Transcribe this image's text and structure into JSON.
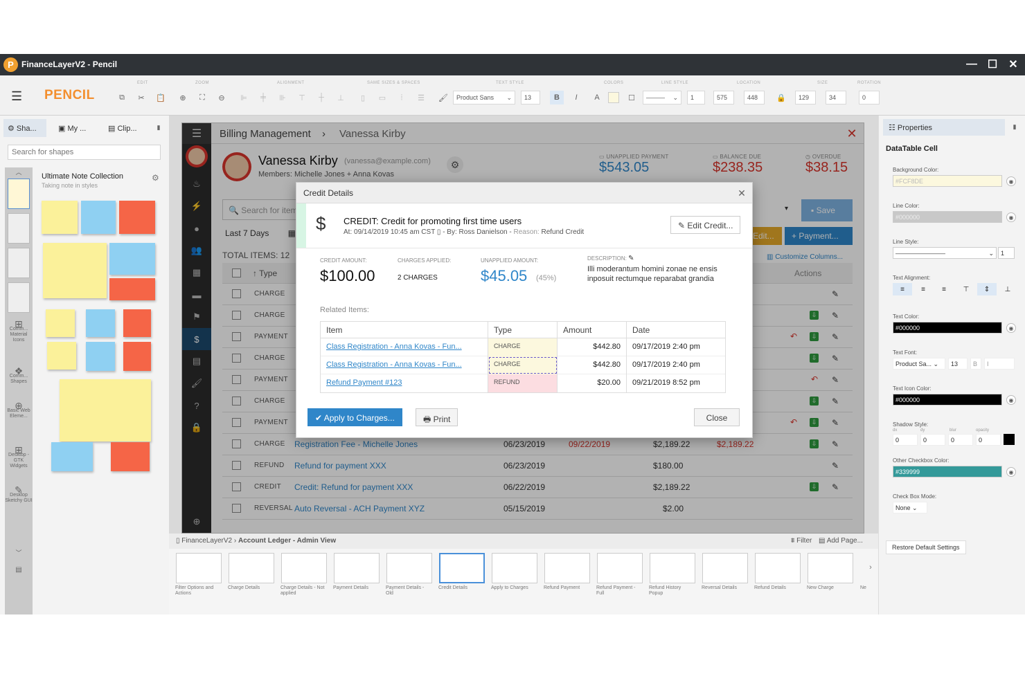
{
  "window": {
    "title": "FinanceLayerV2 - Pencil",
    "logo": "P"
  },
  "toolbar": {
    "brand": "PENCIL",
    "groups": [
      "EDIT",
      "ZOOM",
      "ALIGNMENT",
      "SAME SIZES & SPACES",
      "TEXT STYLE",
      "COLORS",
      "LINE STYLE",
      "LOCATION",
      "SIZE",
      "ROTATION"
    ],
    "font": "Product Sans",
    "font_size": "13",
    "bold": "B",
    "italic": "I",
    "text_color": "A",
    "line_width": "1",
    "x": "575",
    "y": "448",
    "width": "129",
    "height": "34",
    "rotation": "0"
  },
  "left_panel": {
    "tabs": [
      "Sha...",
      "My ...",
      "Clip..."
    ],
    "search_placeholder": "Search for shapes",
    "collection_title": "Ultimate Note Collection",
    "collection_sub": "Taking note in styles",
    "rail_items": [
      "Comm... Material Icons",
      "Comm... Shapes",
      "Basic Web Eleme...",
      "Desktop - GTK Widgets",
      "Desktop Sketchy GUI"
    ]
  },
  "mock": {
    "breadcrumb": [
      "Billing Management",
      "Vanessa Kirby"
    ],
    "customer_name": "Vanessa Kirby",
    "customer_email": "(vanessa@example.com)",
    "members": "Members: Michelle Jones + Anna Kovas",
    "kpis": [
      {
        "label": "UNAPPLIED PAYMENT",
        "value": "$543.05",
        "color": "#2f86c9"
      },
      {
        "label": "BALANCE DUE",
        "value": "$238.35",
        "color": "#d9342b"
      },
      {
        "label": "OVERDUE",
        "value": "$38.15",
        "color": "#d9342b"
      }
    ],
    "search_placeholder": "Search for item",
    "date_filter": "Last 7 Days",
    "save_label": "Save",
    "edit_label": "Edit...",
    "payment_label": "Payment...",
    "total_items": "TOTAL ITEMS: 12",
    "customize_columns": "Customize Columns...",
    "col_type": "Type",
    "col_actions": "Actions",
    "rows": [
      {
        "type": "CHARGE",
        "desc": "",
        "date": "",
        "due": "",
        "amount": "",
        "balance": ""
      },
      {
        "type": "CHARGE",
        "desc": "",
        "date": "",
        "due": "",
        "amount": "",
        "balance": ""
      },
      {
        "type": "PAYMENT",
        "desc": "",
        "date": "",
        "due": "",
        "amount": "",
        "balance": ""
      },
      {
        "type": "CHARGE",
        "desc": "",
        "date": "",
        "due": "",
        "amount": "",
        "balance": ""
      },
      {
        "type": "PAYMENT",
        "desc": "",
        "date": "",
        "due": "",
        "amount": "",
        "balance": ""
      },
      {
        "type": "CHARGE",
        "desc": "",
        "date": "",
        "due": "",
        "amount": "",
        "balance": ""
      },
      {
        "type": "PAYMENT",
        "desc": "",
        "date": "",
        "due": "",
        "amount": "",
        "balance": ""
      },
      {
        "type": "CHARGE",
        "desc": "Registration Fee - Michelle Jones",
        "date": "06/23/2019",
        "due": "09/22/2019",
        "amount": "$2,189.22",
        "balance": "$2,189.22"
      },
      {
        "type": "REFUND",
        "desc": "Refund for payment XXX",
        "date": "06/23/2019",
        "due": "",
        "amount": "$180.00",
        "balance": ""
      },
      {
        "type": "CREDIT",
        "desc": "Credit: Refund for payment XXX",
        "date": "06/22/2019",
        "due": "",
        "amount": "$2,189.22",
        "balance": ""
      },
      {
        "type": "REVERSAL",
        "desc": "Auto Reversal - ACH Payment XYZ",
        "date": "05/15/2019",
        "due": "",
        "amount": "$2.00",
        "balance": ""
      }
    ]
  },
  "dialog": {
    "title": "Credit Details",
    "credit_title": "CREDIT: Credit for promoting first time users",
    "meta_at": "At: 09/14/2019 10:45 am CST",
    "meta_by": "- By: Ross Danielson - ",
    "meta_reason_label": "Reason: ",
    "meta_reason": "Refund Credit",
    "edit_credit": "Edit Credit...",
    "credit_amount_label": "CREDIT AMOUNT:",
    "credit_amount": "$100.00",
    "charges_applied_label": "CHARGES APPLIED:",
    "charges_applied": "2 CHARGES",
    "unapplied_label": "UNAPPLIED AMOUNT:",
    "unapplied": "$45.05",
    "unapplied_pct": "(45%)",
    "description_label": "DESCRIPTION:",
    "description": "Illi moderantum homini zonae ne ensis inposuit rectumque reparabat grandia",
    "related_label": "Related Items:",
    "columns": [
      "Item",
      "Type",
      "Amount",
      "Date"
    ],
    "items": [
      {
        "item": "Class Registration - Anna Kovas - Fun...",
        "type": "CHARGE",
        "amount": "$442.80",
        "date": "09/17/2019 2:40 pm"
      },
      {
        "item": "Class Registration - Anna Kovas - Fun...",
        "type": "CHARGE",
        "amount": "$442.80",
        "date": "09/17/2019 2:40 pm"
      },
      {
        "item": "Refund Payment #123",
        "type": "REFUND",
        "amount": "$20.00",
        "date": "09/21/2019 8:52 pm"
      }
    ],
    "apply_label": "Apply to Charges...",
    "print_label": "Print",
    "close_label": "Close"
  },
  "bottom": {
    "crumb_root": "FinanceLayerV2",
    "crumb_page": "Account Ledger - Admin View",
    "filter": "Filter",
    "add_page": "Add Page...",
    "pages": [
      "Filter Options and Actions",
      "Charge Details",
      "Charge Details - Not applied",
      "Payment Details",
      "Payment Details - Old",
      "Credit Details",
      "Apply to Charges",
      "Refund Payment",
      "Refund Payment - Full",
      "Refund History Popup",
      "Reversal Details",
      "Refund Details",
      "New Charge",
      "Ne"
    ]
  },
  "properties": {
    "tab": "Properties",
    "heading": "DataTable Cell",
    "bg_label": "Background Color:",
    "bg_value": "#FCF8DE",
    "line_color_label": "Line Color:",
    "line_color_value": "#000000",
    "line_style_label": "Line Style:",
    "line_style_value": "1",
    "text_align_label": "Text Alignment:",
    "text_color_label": "Text Color:",
    "text_color_value": "#000000",
    "text_font_label": "Text Font:",
    "text_font_value": "Product Sa...",
    "text_font_size": "13",
    "text_font_b": "B",
    "text_font_i": "I",
    "icon_color_label": "Text Icon Color:",
    "icon_color_value": "#000000",
    "shadow_label": "Shadow Style:",
    "shadow_sub": [
      "dx",
      "dy",
      "blur",
      "opacity"
    ],
    "shadow_vals": [
      "0",
      "0",
      "0",
      "0"
    ],
    "other_cb_label": "Other Checkbox Color:",
    "other_cb_value": "#339999",
    "cb_mode_label": "Check Box Mode:",
    "cb_mode_value": "None",
    "restore": "Restore Default Settings"
  }
}
